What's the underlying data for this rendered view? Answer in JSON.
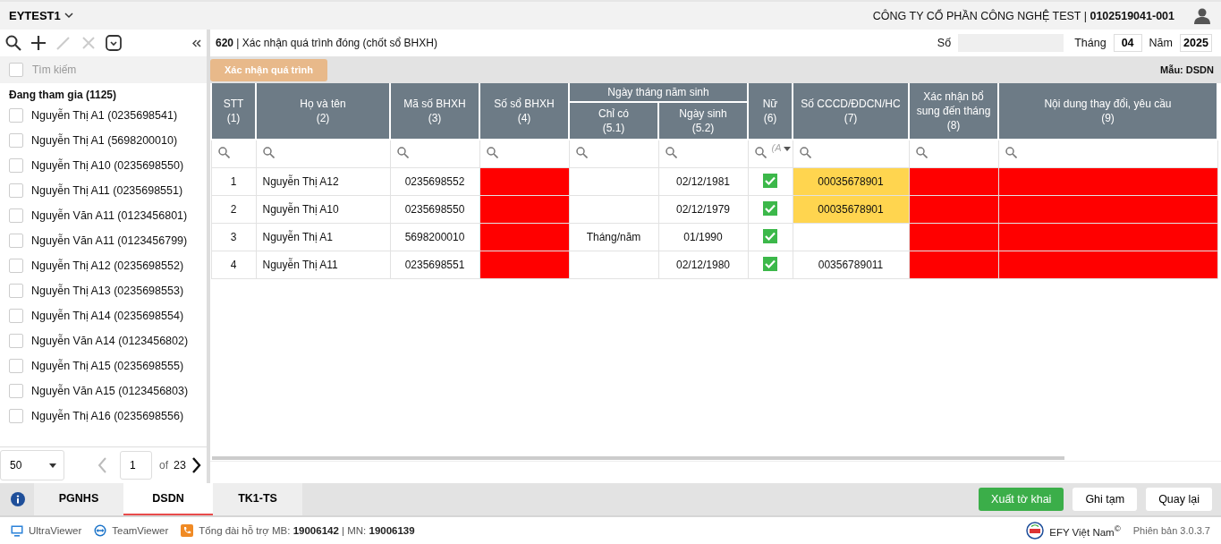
{
  "header": {
    "company_selector": "EYTEST1",
    "company": "CÔNG TY CỔ PHẦN CÔNG NGHỆ TEST | **0102519041-001**"
  },
  "sidebar": {
    "tools": [
      {
        "kind": "search",
        "disabled": false
      },
      {
        "kind": "add",
        "disabled": false
      },
      {
        "kind": "edit",
        "disabled": true
      },
      {
        "kind": "delete",
        "disabled": true
      },
      {
        "kind": "dropdown",
        "disabled": false
      }
    ],
    "search_placeholder": "Tìm kiếm",
    "select_all_checked": false,
    "group": "Đang tham gia (1125)",
    "items": [
      {
        "label": "Nguyễn Thị A1 (0235698541)",
        "checked": false
      },
      {
        "label": "Nguyễn Thị A1 (5698200010)",
        "checked": false
      },
      {
        "label": "Nguyễn Thị A10 (0235698550)",
        "checked": false
      },
      {
        "label": "Nguyễn Thị A11 (0235698551)",
        "checked": false
      },
      {
        "label": "Nguyễn Văn A11 (0123456801)",
        "checked": false
      },
      {
        "label": "Nguyễn Văn A11 (0123456799)",
        "checked": false
      },
      {
        "label": "Nguyễn Thị A12 (0235698552)",
        "checked": false
      },
      {
        "label": "Nguyễn Thị A13 (0235698553)",
        "checked": false
      },
      {
        "label": "Nguyễn Thị A14 (0235698554)",
        "checked": false
      },
      {
        "label": "Nguyễn Văn A14 (0123456802)",
        "checked": false
      },
      {
        "label": "Nguyễn Thị A15 (0235698555)",
        "checked": false
      },
      {
        "label": "Nguyễn Văn A15 (0123456803)",
        "checked": false
      },
      {
        "label": "Nguyễn Thị A16 (0235698556)",
        "checked": false
      }
    ],
    "pagination": {
      "page_size": "50",
      "page": "1",
      "of": "of",
      "total_pages": "23"
    }
  },
  "form": {
    "title": "**620** | Xác nhận quá trình đóng (chốt sổ BHXH)",
    "number_label": "Số",
    "month_label": "Tháng",
    "month": "04",
    "year_label": "Năm",
    "year": "2025",
    "action_button": "Xác nhận quá trình",
    "template": "Mẫu: DSDN"
  },
  "table": {
    "columns": [
      {
        "label": "STT",
        "number": "(1)"
      },
      {
        "label": "Họ và tên",
        "number": "(2)"
      },
      {
        "label": "Mã số BHXH",
        "number": "(3)"
      },
      {
        "label": "Số sổ BHXH",
        "number": "(4)"
      },
      {
        "group": "Ngày tháng năm sinh",
        "colspan": 2,
        "children": [
          {
            "label": "Chỉ có",
            "number": "(5.1)"
          },
          {
            "label": "Ngày sinh",
            "number": "(5.2)"
          }
        ]
      },
      {
        "label": "Nữ",
        "number": "(6)",
        "filter": "(A"
      },
      {
        "label": "Số CCCD/ĐDCN/HC",
        "number": "(7)"
      },
      {
        "label": "Xác nhận bổ sung đến tháng",
        "number": "(8)"
      },
      {
        "label": "Nội dung thay đổi, yêu cầu",
        "number": "(9)"
      }
    ],
    "rows": [
      {
        "cells": [
          {
            "kind": "text",
            "text": "1"
          },
          {
            "kind": "text",
            "text": "Nguyễn Thị A12"
          },
          {
            "kind": "text",
            "text": "0235698552"
          },
          {
            "kind": "text",
            "color": "#ff0000"
          },
          {
            "kind": "text"
          },
          {
            "kind": "text",
            "text": "02/12/1981"
          },
          {
            "kind": "checkbox",
            "checked": true
          },
          {
            "kind": "text",
            "text": "00035678901",
            "color": "#ffd54f"
          },
          {
            "kind": "text",
            "color": "#ff0000"
          },
          {
            "kind": "text",
            "color": "#ff0000"
          }
        ]
      },
      {
        "cells": [
          {
            "kind": "text",
            "text": "2"
          },
          {
            "kind": "text",
            "text": "Nguyễn Thị A10"
          },
          {
            "kind": "text",
            "text": "0235698550"
          },
          {
            "kind": "text",
            "color": "#ff0000"
          },
          {
            "kind": "text"
          },
          {
            "kind": "text",
            "text": "02/12/1979"
          },
          {
            "kind": "checkbox",
            "checked": true
          },
          {
            "kind": "text",
            "text": "00035678901",
            "color": "#ffd54f"
          },
          {
            "kind": "text",
            "color": "#ff0000"
          },
          {
            "kind": "text",
            "color": "#ff0000"
          }
        ]
      },
      {
        "cells": [
          {
            "kind": "text",
            "text": "3"
          },
          {
            "kind": "text",
            "text": "Nguyễn Thị A1"
          },
          {
            "kind": "text",
            "text": "5698200010"
          },
          {
            "kind": "text",
            "color": "#ff0000"
          },
          {
            "kind": "text",
            "text": "Tháng/năm"
          },
          {
            "kind": "text",
            "text": "01/1990"
          },
          {
            "kind": "checkbox",
            "checked": true
          },
          {
            "kind": "text"
          },
          {
            "kind": "text",
            "color": "#ff0000"
          },
          {
            "kind": "text",
            "color": "#ff0000"
          }
        ]
      },
      {
        "cells": [
          {
            "kind": "text",
            "text": "4"
          },
          {
            "kind": "text",
            "text": "Nguyễn Thị A11"
          },
          {
            "kind": "text",
            "text": "0235698551"
          },
          {
            "kind": "text",
            "color": "#ff0000"
          },
          {
            "kind": "text"
          },
          {
            "kind": "text",
            "text": "02/12/1980"
          },
          {
            "kind": "checkbox",
            "checked": true
          },
          {
            "kind": "text",
            "text": "00356789011"
          },
          {
            "kind": "text",
            "color": "#ff0000"
          },
          {
            "kind": "text",
            "color": "#ff0000"
          }
        ]
      }
    ]
  },
  "tabs": [
    {
      "label": "PGNHS",
      "selected": false
    },
    {
      "label": "DSDN",
      "selected": true
    },
    {
      "label": "TK1-TS",
      "selected": false
    }
  ],
  "buttons": [
    {
      "label": "Xuất tờ khai",
      "kind": "primary"
    },
    {
      "label": "Ghi tạm",
      "kind": "default"
    },
    {
      "label": "Quay lại",
      "kind": "default"
    }
  ],
  "footer": {
    "links": [
      {
        "kind": "monitor",
        "label": "UltraViewer"
      },
      {
        "kind": "teamviewer",
        "label": "TeamViewer"
      },
      {
        "kind": "phone",
        "label": "Tổng đài hỗ trợ MB: **19006142** | MN: **19006139**"
      }
    ],
    "brand": "EFY Việt Nam$^{©}$",
    "version": "Phiên bản 3.0.3.7"
  }
}
